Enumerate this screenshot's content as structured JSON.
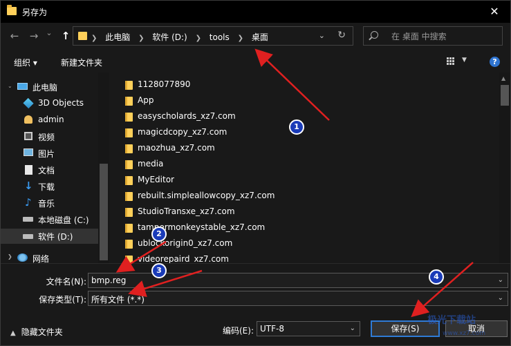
{
  "window": {
    "title": "另存为",
    "close_label": "✕"
  },
  "nav": {
    "back_label": "←",
    "forward_label": "→",
    "recent_label": "⌄",
    "up_label": "↑",
    "breadcrumbs": [
      "此电脑",
      "软件 (D:)",
      "tools",
      "桌面"
    ],
    "search_placeholder": "在 桌面 中搜索"
  },
  "toolbar": {
    "organize_label": "组织 ▾",
    "new_folder_label": "新建文件夹",
    "help_label": "?"
  },
  "sidebar": {
    "items": [
      {
        "label": "此电脑",
        "icon": "computer-icon"
      },
      {
        "label": "3D Objects",
        "icon": "cube-icon"
      },
      {
        "label": "admin",
        "icon": "user-icon"
      },
      {
        "label": "视频",
        "icon": "video-icon"
      },
      {
        "label": "图片",
        "icon": "picture-icon"
      },
      {
        "label": "文档",
        "icon": "document-icon"
      },
      {
        "label": "下载",
        "icon": "download-icon"
      },
      {
        "label": "音乐",
        "icon": "music-icon"
      },
      {
        "label": "本地磁盘 (C:)",
        "icon": "drive-icon"
      },
      {
        "label": "软件 (D:)",
        "icon": "drive-icon"
      },
      {
        "label": "网络",
        "icon": "network-icon"
      }
    ]
  },
  "files": [
    "1128077890",
    "App",
    "easyscholards_xz7.com",
    "magicdcopy_xz7.com",
    "maozhua_xz7.com",
    "media",
    "MyEditor",
    "rebuilt.simpleallowcopy_xz7.com",
    "StudioTransxe_xz7.com",
    "tampermonkeystable_xz7.com",
    "ublockorigin0_xz7.com",
    "videorepaird_xz7.com"
  ],
  "form": {
    "filename_label": "文件名(N):",
    "filename_value": "bmp.reg",
    "filetype_label": "保存类型(T):",
    "filetype_value": "所有文件  (*.*)",
    "encoding_label": "编码(E):",
    "encoding_value": "UTF-8",
    "save_label": "保存(S)",
    "cancel_label": "取消",
    "hide_folders_label": "隐藏文件夹"
  },
  "annotations": {
    "badges": [
      "1",
      "2",
      "3",
      "4"
    ],
    "arrow_color": "#e02020"
  },
  "watermark": {
    "text": "极光下载站",
    "sub": "www.xz7.com"
  },
  "colors": {
    "accent": "#2f7bd6",
    "folder": "#ffd05a",
    "background": "#191919"
  }
}
